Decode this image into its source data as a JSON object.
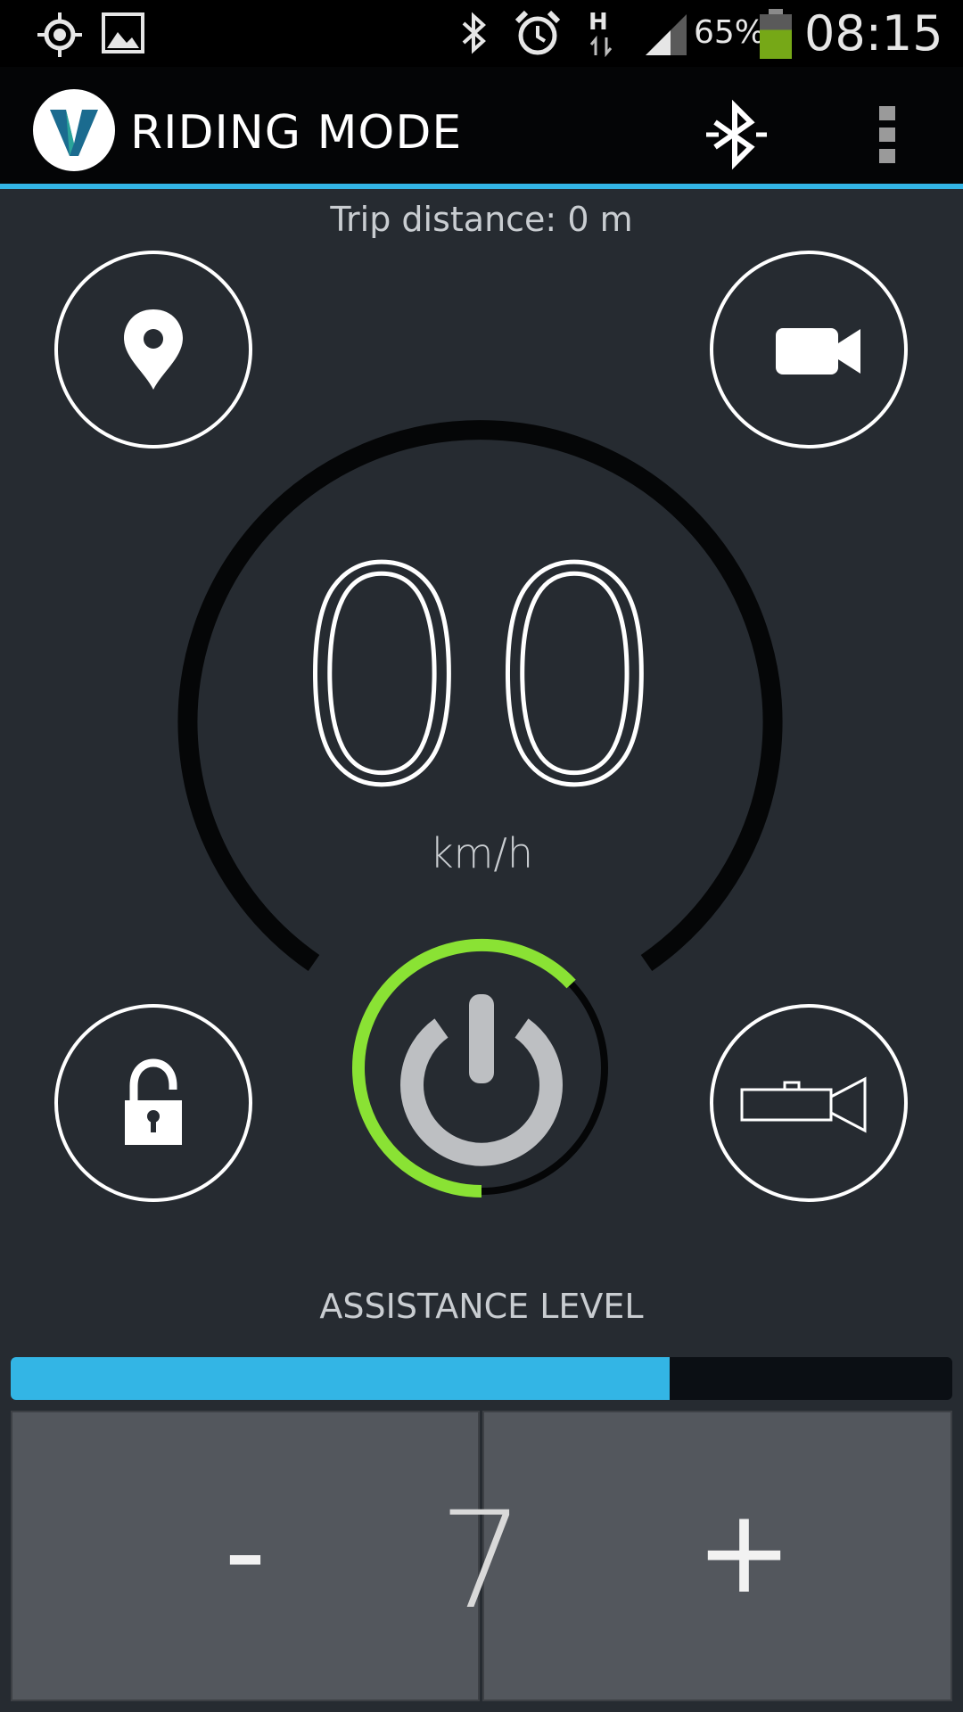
{
  "status_bar": {
    "battery_percent": "65%",
    "time": "08:15",
    "network_type": "H",
    "battery_level": 0.65,
    "icons": [
      "gps-icon",
      "picture-icon",
      "bluetooth-icon",
      "alarm-icon",
      "network-h-icon",
      "signal-icon",
      "battery-icon"
    ]
  },
  "action_bar": {
    "title": "RIDING MODE",
    "logo_letter": "V",
    "actions": [
      "bluetooth-icon",
      "overflow-menu-icon"
    ]
  },
  "trip": {
    "label": "Trip distance: 0 m"
  },
  "speedometer": {
    "value": "00",
    "unit": "km/h"
  },
  "buttons": {
    "location": "map-pin-icon",
    "camera": "video-camera-icon",
    "lock": "unlocked-padlock-icon",
    "horn": "horn-icon",
    "power": "power-icon",
    "power_progress": 0.63
  },
  "assistance": {
    "title": "ASSISTANCE LEVEL",
    "level": "7",
    "fill_fraction": 0.7,
    "minus_label": "-",
    "plus_label": "+"
  },
  "colors": {
    "accent": "#33b5e5",
    "power_ring": "#8ae234",
    "background": "#262b31"
  }
}
